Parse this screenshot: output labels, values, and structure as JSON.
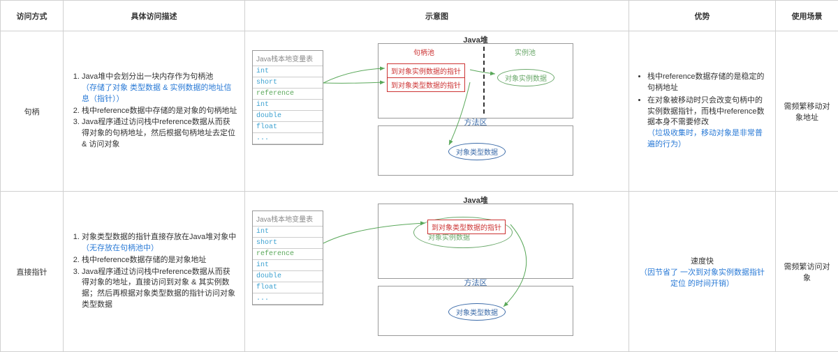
{
  "headers": {
    "c0": "访问方式",
    "c1": "具体访问描述",
    "c2": "示意图",
    "c3": "优势",
    "c4": "使用场景"
  },
  "row1": {
    "name": "句柄",
    "desc1": "Java堆中会划分出一块内存作为句柄池",
    "desc1_note": "（存储了对象 类型数据 & 实例数据的地址信息（指针））",
    "desc2": "栈中reference数据中存储的是对象的句柄地址",
    "desc3": "Java程序通过访问栈中reference数据从而获得对象的句柄地址，然后根据句柄地址去定位 & 访问对象",
    "diagram": {
      "stack_title": "Java栈本地变量表",
      "types": [
        "int",
        "short",
        "reference",
        "int",
        "double",
        "float",
        "..."
      ],
      "heap_title": "Java堆",
      "handle_pool": "句柄池",
      "instance_pool": "实例池",
      "ptr_instance": "到对象实例数据的指针",
      "ptr_type": "到对象类型数据的指针",
      "instance_data": "对象实例数据",
      "method_title": "方法区",
      "type_data": "对象类型数据"
    },
    "adv1": "栈中reference数据存储的是稳定的句柄地址",
    "adv2": "在对象被移动时只会改变句柄中的实例数据指针，而栈中reference数据本身不需要修改",
    "adv2_note": "（垃圾收集时，移动对象是非常普遍的行为）",
    "scene": "需频繁移动对象地址"
  },
  "row2": {
    "name": "直接指针",
    "desc1": "对象类型数据的指针直接存放在Java堆对象中",
    "desc1_note": "（无存放在句柄池中）",
    "desc2": "栈中reference数据存储的是对象地址",
    "desc3": "Java程序通过访问栈中reference数据从而获得对象的地址，直接访问到对象 & 其实例数据；然后再根据对象类型数据的指针访问对象类型数据",
    "diagram": {
      "stack_title": "Java栈本地变量表",
      "types": [
        "int",
        "short",
        "reference",
        "int",
        "double",
        "float",
        "..."
      ],
      "heap_title": "Java堆",
      "ptr_type": "到对象类型数据的指针",
      "instance_data": "对象实例数据",
      "method_title": "方法区",
      "type_data": "对象类型数据"
    },
    "adv1": "速度快",
    "adv1_note": "（因节省了 一次到对象实例数据指针定位 的时间开销）",
    "scene": "需频繁访问对象"
  }
}
